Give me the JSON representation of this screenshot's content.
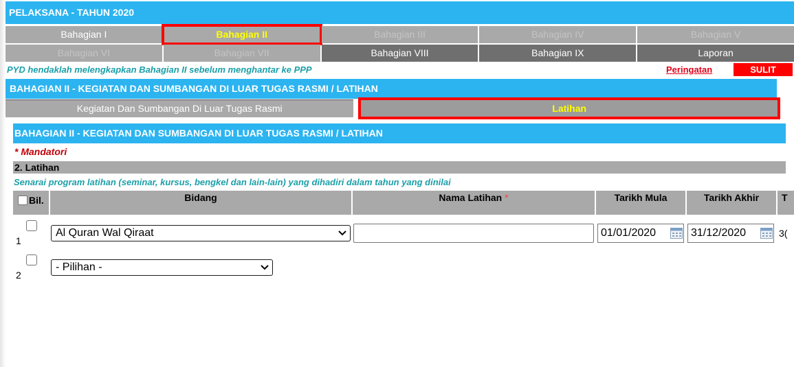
{
  "title": "PELAKSANA - TAHUN 2020",
  "tabs": {
    "row1": [
      {
        "label": "Bahagian I",
        "state": "enabled"
      },
      {
        "label": "Bahagian II",
        "state": "active"
      },
      {
        "label": "Bahagian III",
        "state": "disabled"
      },
      {
        "label": "Bahagian IV",
        "state": "disabled"
      },
      {
        "label": "Bahagian V",
        "state": "disabled"
      }
    ],
    "row2": [
      {
        "label": "Bahagian VI",
        "state": "disabled"
      },
      {
        "label": "Bahagian VII",
        "state": "disabled"
      },
      {
        "label": "Bahagian VIII",
        "state": "enabled"
      },
      {
        "label": "Bahagian IX",
        "state": "enabled"
      },
      {
        "label": "Laporan",
        "state": "enabled"
      }
    ]
  },
  "notice": "PYD hendaklah melengkapkan Bahagian II sebelum menghantar ke PPP",
  "warning_link": "Peringatan",
  "classification": "SULIT",
  "section_title": "BAHAGIAN II - KEGIATAN DAN SUMBANGAN DI LUAR TUGAS RASMI / LATIHAN",
  "subtabs": [
    {
      "label": "Kegiatan Dan Sumbangan Di Luar Tugas Rasmi",
      "state": "enabled"
    },
    {
      "label": "Latihan",
      "state": "active"
    }
  ],
  "form": {
    "header": "BAHAGIAN II - KEGIATAN DAN SUMBANGAN DI LUAR TUGAS RASMI / LATIHAN",
    "mandatory_note": "* Mandatori",
    "sub_header": "2. Latihan",
    "description": "Senarai program latihan (seminar, kursus, bengkel dan lain-lain) yang dihadiri dalam tahun yang dinilai",
    "columns": {
      "bil": "Bil.",
      "bidang": "Bidang",
      "nama_latihan": "Nama Latihan",
      "required_mark": "*",
      "tarikh_mula": "Tarikh Mula",
      "tarikh_akhir": "Tarikh Akhir",
      "extra": "T"
    },
    "rows": [
      {
        "number": "1",
        "bidang": "Al Quran Wal Qiraat",
        "nama_latihan": "",
        "tarikh_mula": "01/01/2020",
        "tarikh_akhir": "31/12/2020",
        "extra": "3("
      },
      {
        "number": "2",
        "bidang": "- Pilihan -"
      }
    ]
  },
  "colors": {
    "header_blue": "#2cb4f0",
    "tab_grey": "#a9a9a9",
    "active_yellow": "#ffff00",
    "highlight_red": "#ff0000",
    "teal_text": "#1a9fa8"
  }
}
